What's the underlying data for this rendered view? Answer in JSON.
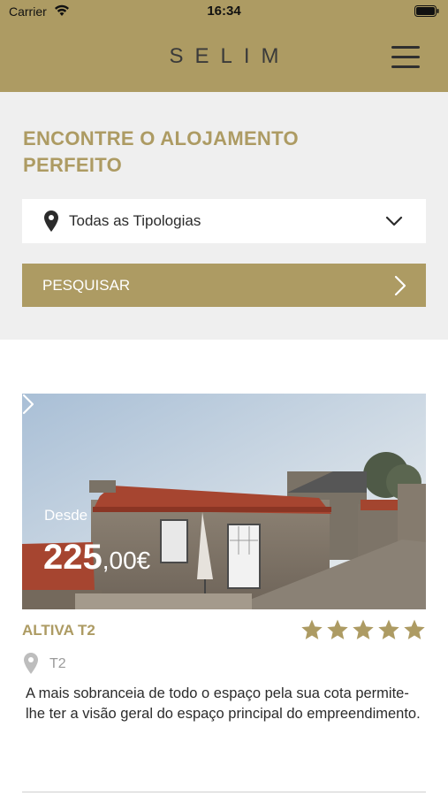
{
  "status_bar": {
    "carrier": "Carrier",
    "time": "16:34",
    "wifi_icon": "wifi-icon",
    "battery_icon": "battery-icon"
  },
  "header": {
    "brand": "SELIM",
    "menu_icon": "hamburger-menu-icon",
    "background": "#ad9b63"
  },
  "search": {
    "title": "ENCONTRE O ALOJAMENTO PERFEITO",
    "select_value": "Todas as Tipologias",
    "select_icon": "location-pin-icon",
    "dropdown_icon": "chevron-down-icon",
    "button_label": "PESQUISAR",
    "button_icon": "chevron-right-icon",
    "panel_background": "#efefef"
  },
  "listing": {
    "from_label": "Desde",
    "price_integer": "225",
    "price_decimal": ",00€",
    "name": "ALTIVA T2",
    "rating_stars": 5,
    "rating_max": 5,
    "type": "T2",
    "description": "A mais sobranceia de todo o espaço pela sua cota permite-lhe ter a visão geral do espaço principal do empreendimento.",
    "accent": "#ad9b63"
  }
}
